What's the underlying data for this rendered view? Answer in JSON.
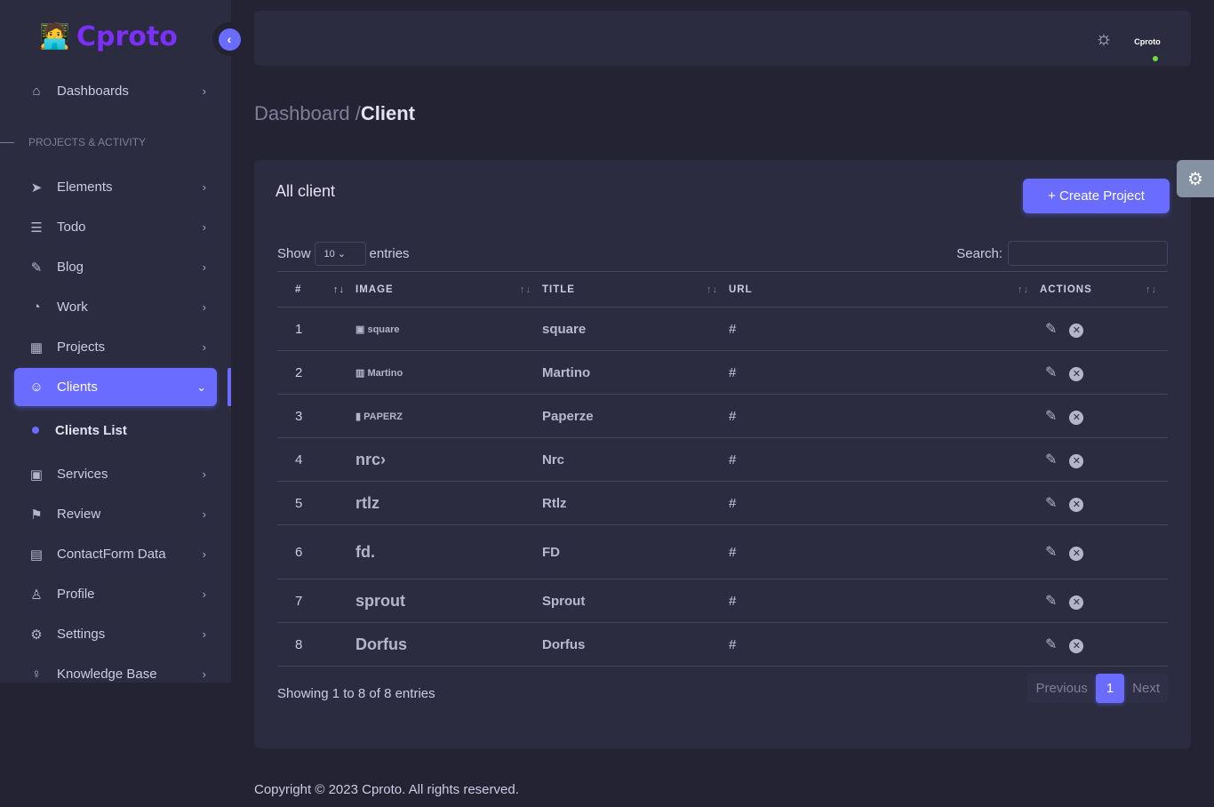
{
  "brand": {
    "name": "Cproto"
  },
  "sidebar": {
    "section": "PROJECTS & ACTIVITY",
    "items": [
      {
        "label": "Dashboards",
        "icon": "home-icon",
        "glyph": "⌂"
      },
      {
        "label": "Elements",
        "icon": "send-icon",
        "glyph": "➤"
      },
      {
        "label": "Todo",
        "icon": "list-icon",
        "glyph": "☰"
      },
      {
        "label": "Blog",
        "icon": "blog-icon",
        "glyph": "✎"
      },
      {
        "label": "Work",
        "icon": "timer-icon",
        "glyph": "◔"
      },
      {
        "label": "Projects",
        "icon": "calendar-icon",
        "glyph": "▦"
      },
      {
        "label": "Clients",
        "icon": "contact-icon",
        "glyph": "☺"
      },
      {
        "label": "Services",
        "icon": "briefcase-icon",
        "glyph": "▣"
      },
      {
        "label": "Review",
        "icon": "bookmark-icon",
        "glyph": "⚑"
      },
      {
        "label": "ContactForm Data",
        "icon": "contact-book-icon",
        "glyph": "▤"
      },
      {
        "label": "Profile",
        "icon": "user-icon",
        "glyph": "♙"
      },
      {
        "label": "Settings",
        "icon": "gear-icon",
        "glyph": "⚙"
      },
      {
        "label": "Knowledge Base",
        "icon": "bulb-icon",
        "glyph": "♀"
      }
    ],
    "sub_item": "Clients List"
  },
  "breadcrumb": {
    "parent": "Dashboard /",
    "current": "Client"
  },
  "card": {
    "title": "All client",
    "create_button": "+  Create Project"
  },
  "table_controls": {
    "show": "Show",
    "entries_value": "10",
    "entries": "entries",
    "search_label": "Search:",
    "search_value": ""
  },
  "columns": [
    "#",
    "IMAGE",
    "TITLE",
    "URL",
    "ACTIONS"
  ],
  "rows": [
    {
      "n": "1",
      "logo": "▣ square",
      "title": "square",
      "url": "#"
    },
    {
      "n": "2",
      "logo": "▥ Martino",
      "title": "Martino",
      "url": "#"
    },
    {
      "n": "3",
      "logo": "▮ PAPERZ",
      "title": "Paperze",
      "url": "#"
    },
    {
      "n": "4",
      "logo": "nrc›",
      "title": "Nrc",
      "url": "#"
    },
    {
      "n": "5",
      "logo": "rtlz",
      "title": "Rtlz",
      "url": "#"
    },
    {
      "n": "6",
      "logo": "fd.",
      "title": "FD",
      "url": "#"
    },
    {
      "n": "7",
      "logo": "sprout",
      "title": "Sprout",
      "url": "#"
    },
    {
      "n": "8",
      "logo": "Dorfus",
      "title": "Dorfus",
      "url": "#"
    }
  ],
  "info": "Showing 1 to 8 of 8 entries",
  "pagination": {
    "prev": "Previous",
    "page": "1",
    "next": "Next"
  },
  "footer": "Copyright © 2023 Cproto. All rights reserved.",
  "avatar_label": "Cproto"
}
